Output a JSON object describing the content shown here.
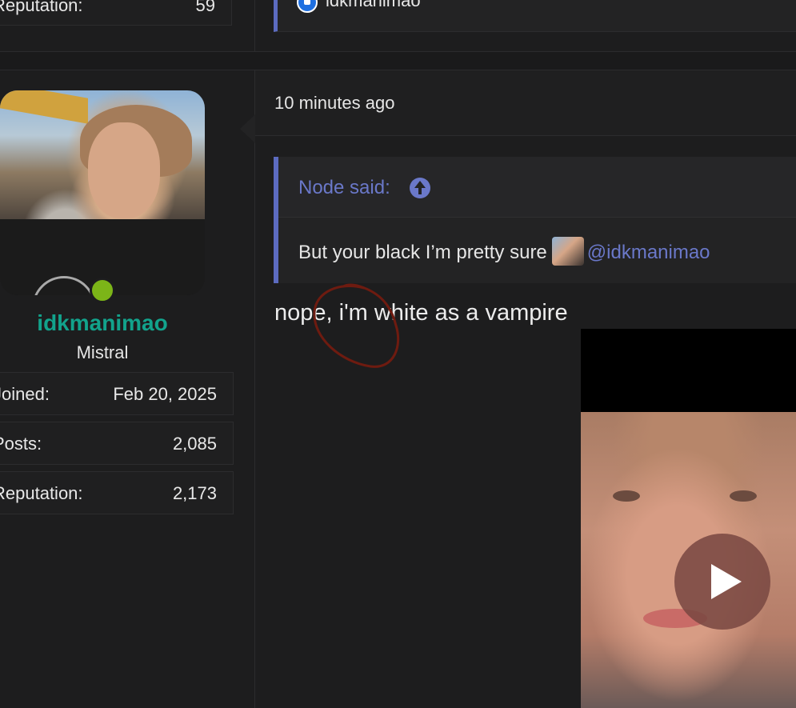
{
  "previous_post": {
    "stat_label": "Reputation:",
    "stat_value": "59",
    "reaction_user": "idkmanimao"
  },
  "post": {
    "time": "10 minutes ago",
    "quote": {
      "attribution": "Node said:",
      "body_text": "But your black I’m pretty sure",
      "mention": "@idkmanimao"
    },
    "text": "nope, i'm white as a vampire"
  },
  "author": {
    "username": "idkmanimao",
    "title": "Mistral",
    "username_color": "#12a38c",
    "status": "online",
    "stats": [
      {
        "label": "Joined:",
        "value": "Feb 20, 2025"
      },
      {
        "label": "Posts:",
        "value": "2,085"
      },
      {
        "label": "Reputation:",
        "value": "2,173"
      }
    ]
  },
  "colors": {
    "background": "#1d1d1e",
    "quote_accent": "#5c6bc0",
    "link": "#6a78c9",
    "online": "#7cb518"
  },
  "icons": {
    "reaction": "like-icon",
    "quote_jump": "arrow-up-circle-icon",
    "video": "play-icon"
  }
}
